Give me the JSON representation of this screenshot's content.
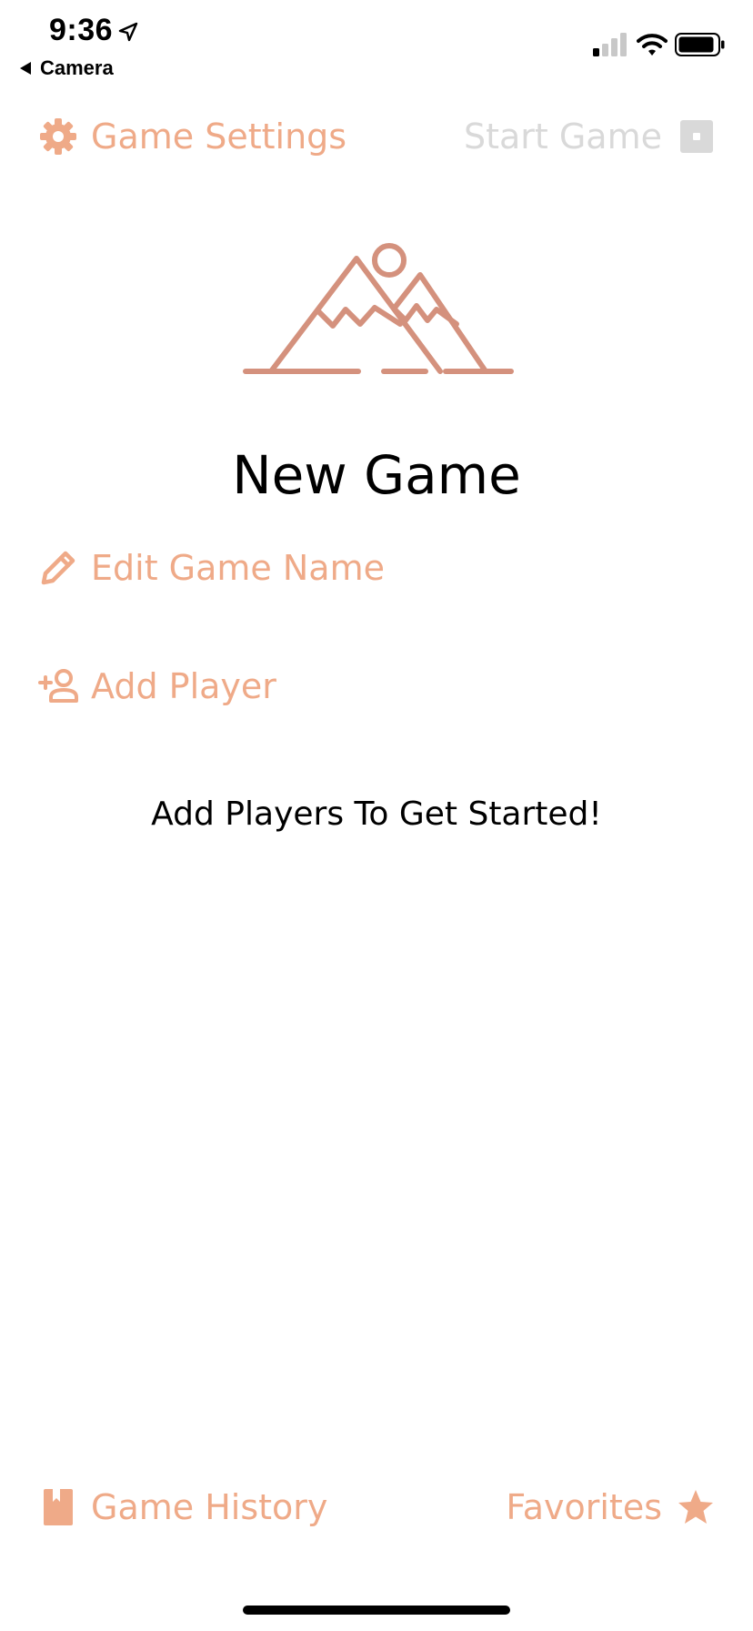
{
  "status_bar": {
    "time": "9:36",
    "back_label": "Camera"
  },
  "header": {
    "settings_label": "Game Settings",
    "start_label": "Start Game"
  },
  "main": {
    "title": "New Game",
    "edit_name_label": "Edit Game Name",
    "add_player_label": "Add Player",
    "empty_hint": "Add Players To Get Started!"
  },
  "footer": {
    "history_label": "Game History",
    "favorites_label": "Favorites"
  },
  "colors": {
    "accent": "#efaa88",
    "illustration": "#d4917d",
    "disabled": "#d9d9d9",
    "text": "#000000",
    "background": "#ffffff"
  },
  "icons": {
    "settings": "gear-icon",
    "start": "stop-square-icon",
    "illustration": "mountain-sun-icon",
    "edit": "pencil-icon",
    "add_player": "add-person-icon",
    "history": "book-icon",
    "favorites": "star-icon"
  }
}
